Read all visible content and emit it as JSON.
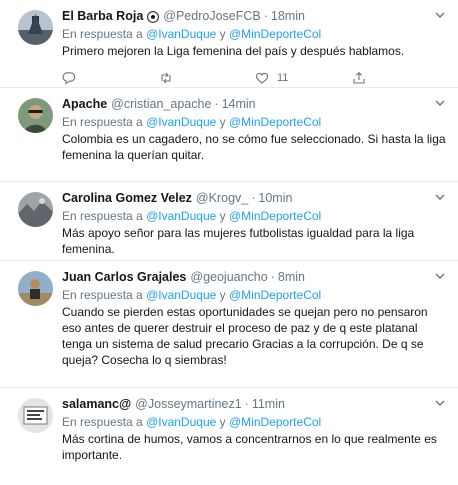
{
  "common": {
    "in_reply_prefix": "En respuesta a",
    "mention1": "@IvanDuque",
    "and_word": "y",
    "mention2": "@MinDeporteCol",
    "separator": "·",
    "colors": {
      "link": "#1da1f2",
      "muted": "#657786",
      "text": "#14171a",
      "divider": "#e6ecf0"
    }
  },
  "tweets": [
    {
      "name": "El Barba Roja",
      "badge_icon": "soccer-ball-icon",
      "handle": "@PedroJoseFCB",
      "time": "18min",
      "text": "Primero mejoren la Liga femenina del país y después hablamos.",
      "likes": "11"
    },
    {
      "name": "Apache",
      "handle": "@cristian_apache",
      "time": "14min",
      "text": "Colombia es un cagadero, no se cómo fue seleccionado. Si hasta la liga femenina la querían quitar.",
      "likes": ""
    },
    {
      "name": "Carolina Gomez Velez",
      "handle": "@Krogv_",
      "time": "10min",
      "text": "Más apoyo señor para las mujeres futbolistas igualdad para la liga femenina.",
      "likes": ""
    },
    {
      "name": "Juan Carlos Grajales",
      "handle": "@geojuancho",
      "time": "8min",
      "text": "Cuando se pierden estas oportunidades se quejan pero no pensaron eso antes de querer destruir el proceso de paz y de q este platanal tenga un sistema de salud precario Gracias a la corrupción. De q se queja? Cosecha lo q siembras!",
      "likes": ""
    },
    {
      "name": "salamanc@",
      "handle": "@Josseymartinez1",
      "time": "11min",
      "text": "Más cortina de humos, vamos a concentrarnos en lo que realmente es importante.",
      "likes": ""
    }
  ]
}
